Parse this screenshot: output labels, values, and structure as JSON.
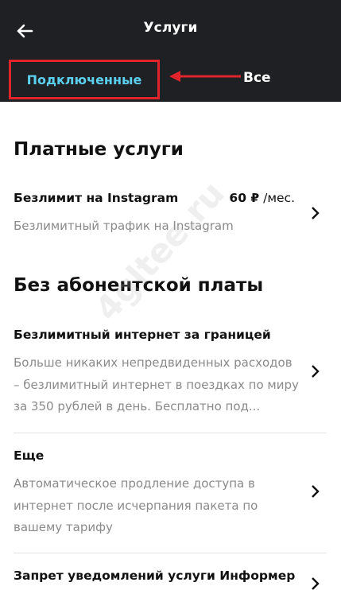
{
  "header": {
    "title": "Услуги",
    "back_icon": "arrow-left-icon",
    "tabs": [
      {
        "label": "Подключенные",
        "active": true
      },
      {
        "label": "Все",
        "active": false
      }
    ]
  },
  "sections": [
    {
      "title": "Платные услуги",
      "items": [
        {
          "name": "Безлимит на Instagram",
          "price": "60 ₽",
          "price_period": " /мес.",
          "description": "Безлимитный трафик на Instagram"
        }
      ]
    },
    {
      "title": "Без абонентской платы",
      "items": [
        {
          "name": "Безлимитный интернет за границей",
          "description": "Больше никаких непредвиденных расходов – безлимитный интернет в поездках по миру за 350 рублей в день. Бесплатно под..."
        },
        {
          "name": "Еще",
          "description": "Автоматическое продление доступа в интернет после исчерпания пакета по вашему тарифу"
        },
        {
          "name": "Запрет уведомлений услуги Информер",
          "description": ""
        }
      ]
    }
  ],
  "watermark": "4gltee.ru",
  "colors": {
    "header_bg": "#1f2024",
    "active_tab": "#5bd0ee",
    "annotation": "#e0242b"
  }
}
